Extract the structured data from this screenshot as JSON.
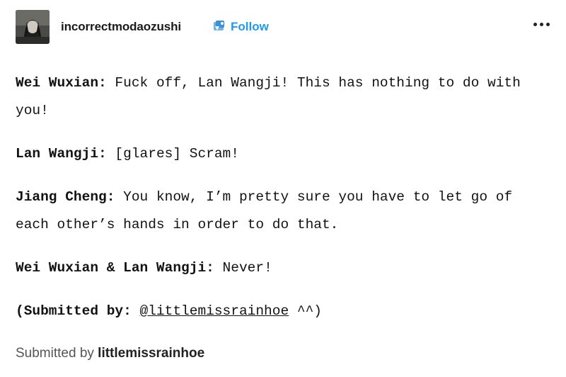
{
  "header": {
    "avatar_icon": "avatar-icon",
    "username": "incorrectmodaozushi",
    "badge_icon": "badge-icon",
    "follow_label": "Follow",
    "more_icon": "more-icon",
    "accent_color": "#1d9bf0"
  },
  "post": {
    "lines": [
      {
        "speaker": "Wei Wuxian:",
        "text": " Fuck off, Lan Wangji! This has nothing to do with you!"
      },
      {
        "speaker": "Lan Wangji:",
        "text": " [glares] Scram!"
      },
      {
        "speaker": "Jiang Cheng:",
        "text": " You know, I’m pretty sure you have to let go of each other’s hands in order to do that."
      },
      {
        "speaker": "Wei Wuxian & Lan Wangji:",
        "text": " Never!"
      }
    ],
    "submission": {
      "open": "(",
      "label": "Submitted by:",
      "handle": "@littlemissrainhoe",
      "close": " ^^)"
    }
  },
  "footer": {
    "prefix": "Submitted by ",
    "name": "littlemissrainhoe"
  }
}
